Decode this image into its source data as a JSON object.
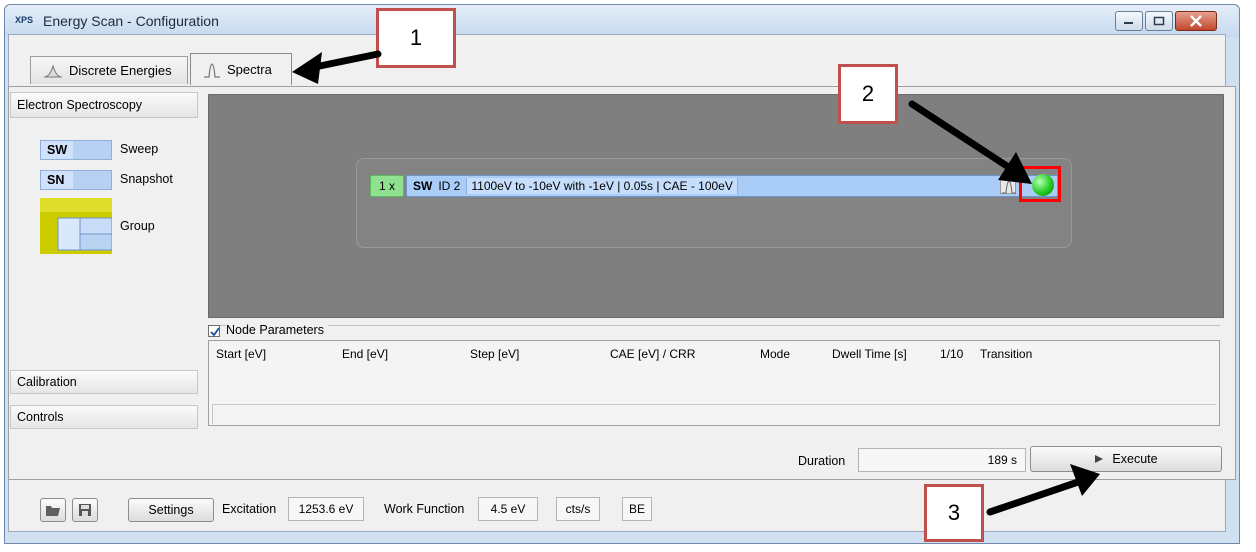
{
  "window": {
    "app_icon": "XPS",
    "title": "Energy Scan - Configuration",
    "controls": [
      "minimize-icon",
      "maximize-icon",
      "close-icon"
    ]
  },
  "tabs": [
    {
      "label": "Discrete Energies",
      "icon": "bell-curve-icon",
      "active": false
    },
    {
      "label": "Spectra",
      "icon": "spectrum-icon",
      "active": true
    }
  ],
  "sidebar": {
    "header": "Electron Spectroscopy",
    "items": [
      {
        "chip": "SW",
        "label": "Sweep"
      },
      {
        "chip": "SN",
        "label": "Snapshot"
      },
      {
        "chip": "",
        "label": "Group"
      }
    ],
    "calibration": "Calibration",
    "controls": "Controls"
  },
  "node": {
    "repeat": "1 x",
    "type": "SW",
    "id": "ID 2",
    "summary": "1100eV to -10eV with -1eV | 0.05s | CAE - 100eV",
    "status_color": "#22cc22"
  },
  "node_parameters": {
    "label": "Node Parameters",
    "checked": true,
    "columns": [
      "Start [eV]",
      "End [eV]",
      "Step [eV]",
      "CAE [eV] / CRR",
      "Mode",
      "Dwell Time [s]",
      "1/10",
      "Transition"
    ]
  },
  "duration": {
    "label": "Duration",
    "value": "189 s"
  },
  "execute": {
    "label": "Execute",
    "icon": "play-icon"
  },
  "footer": {
    "settings_label": "Settings",
    "excitation_label": "Excitation",
    "excitation_value": "1253.6 eV",
    "work_function_label": "Work Function",
    "work_function_value": "4.5 eV",
    "units": "cts/s",
    "energy_mode": "BE"
  },
  "annotations": [
    {
      "number": "1"
    },
    {
      "number": "2"
    },
    {
      "number": "3"
    }
  ],
  "colors": {
    "annotation_border": "#c0504d",
    "arrow": "#000000",
    "highlight": "#ff0000"
  }
}
